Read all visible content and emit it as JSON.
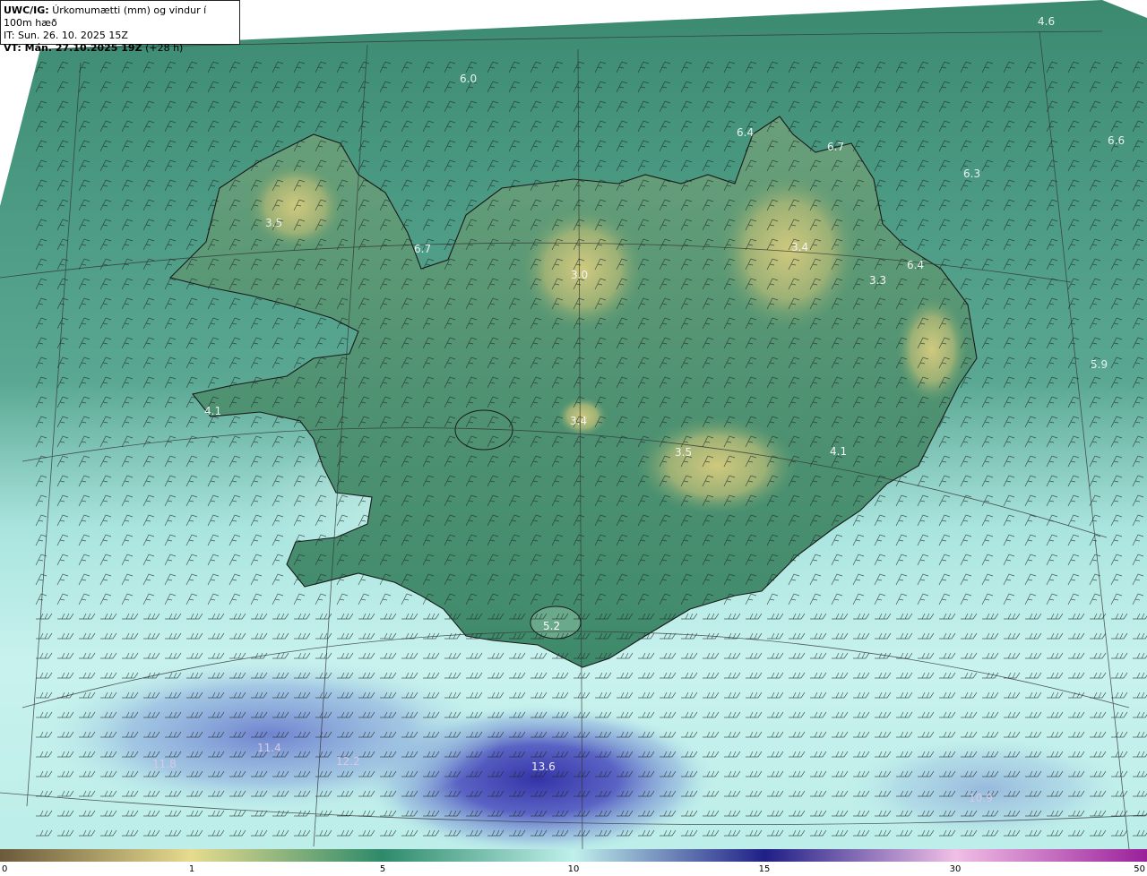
{
  "header": {
    "code": "UWC/IG:",
    "title": "Úrkomumætti (mm) og vindur í 100m hæð",
    "issue_time": "IT: Sun. 26. 10. 2025 15Z",
    "valid_label": "VT: Mán. 27.10.2025 19Z",
    "lead_time": "(+28 h)"
  },
  "colors": {
    "low": "#6b5a3c",
    "mid_low": "#d9cf86",
    "mid": "#2e8a6a",
    "mid_high": "#bff0ec",
    "high": "#2a2a9c",
    "max": "#9a1f9a",
    "land_high": "#c9c47c",
    "land_low": "#2f7a5c",
    "sea": "#3c8c72"
  },
  "value_labels": [
    {
      "text": "4.6",
      "tone": "light"
    },
    {
      "text": "6.0",
      "tone": "light"
    },
    {
      "text": "6.4",
      "tone": "light"
    },
    {
      "text": "6.7",
      "tone": "light"
    },
    {
      "text": "6.6",
      "tone": "light"
    },
    {
      "text": "6.3",
      "tone": "light"
    },
    {
      "text": "3.5",
      "tone": "light"
    },
    {
      "text": "6.7",
      "tone": "light"
    },
    {
      "text": "3.4",
      "tone": "light"
    },
    {
      "text": "3.0",
      "tone": "light"
    },
    {
      "text": "3.3",
      "tone": "light"
    },
    {
      "text": "6.4",
      "tone": "light"
    },
    {
      "text": "5.9",
      "tone": "light"
    },
    {
      "text": "4.1",
      "tone": "light"
    },
    {
      "text": "3.4",
      "tone": "light"
    },
    {
      "text": "3.5",
      "tone": "light"
    },
    {
      "text": "4.1",
      "tone": "light"
    },
    {
      "text": "5.2",
      "tone": "light"
    },
    {
      "text": "11.8",
      "tone": "pale"
    },
    {
      "text": "11.4",
      "tone": "pale"
    },
    {
      "text": "12.2",
      "tone": "pale"
    },
    {
      "text": "13.6",
      "tone": "light"
    },
    {
      "text": "10.9",
      "tone": "pale"
    }
  ],
  "colorbar": {
    "ticks": [
      "0",
      "1",
      "5",
      "10",
      "15",
      "30",
      "50"
    ]
  }
}
